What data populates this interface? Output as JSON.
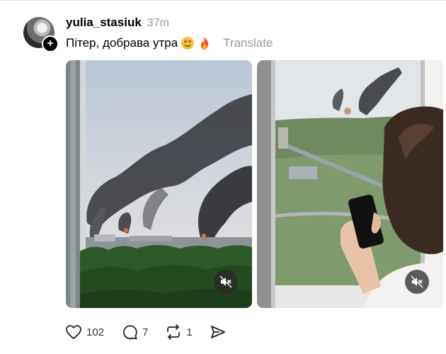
{
  "post": {
    "username": "yulia_stasiuk",
    "time": "37m",
    "caption_text": "Пітер, добрава утра",
    "translate_label": "Translate"
  },
  "media": [
    {
      "icon": "speaker-muted-icon"
    },
    {
      "icon": "speaker-muted-icon"
    }
  ],
  "actions": {
    "likes": "102",
    "replies": "7",
    "reposts": "1"
  },
  "icons": {
    "follow": "plus-icon",
    "like": "heart-icon",
    "reply": "comment-icon",
    "repost": "repost-icon",
    "share": "send-icon"
  }
}
